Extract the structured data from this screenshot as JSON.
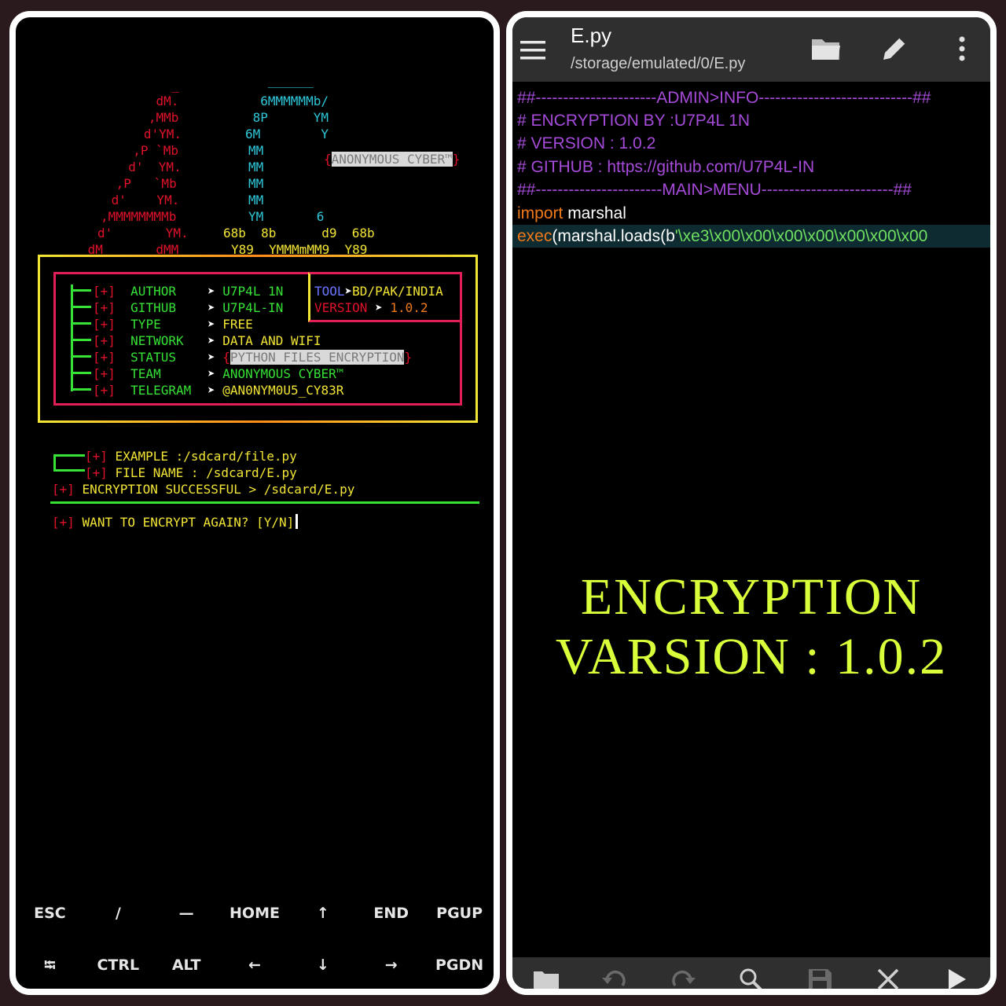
{
  "terminal": {
    "ascii_a": [
      "     _",
      "    dM.",
      "   ,MMb",
      "   d'YM.",
      "  ,P `Mb",
      "  d'  YM.",
      " ,P   `Mb",
      " d'    YM.",
      ",MMMMMMMMb",
      "d'       YM."
    ],
    "ascii_a_last": "_dM_     _dMM_",
    "ascii_c_cyan": [
      "   ______",
      "  6MMMMMMb/",
      " 8P      YM",
      "6M        Y",
      "MM",
      "MM",
      "MM",
      "MM",
      "YM       6"
    ],
    "ascii_c_tail1": "68b  8b      d9  68b",
    "ascii_c_tail2": "Y89  YMMMmMM9  Y89",
    "badge": "ANONYMOUS CYBER™",
    "info_rows": [
      {
        "tag": "[+]",
        "key": "AUTHOR",
        "value": "U7P4L 1N"
      },
      {
        "tag": "[+]",
        "key": "GITHUB",
        "value": "U7P4L-IN"
      },
      {
        "tag": "[+]",
        "key": "TYPE",
        "value": "FREE"
      },
      {
        "tag": "[+]",
        "key": "NETWORK",
        "value": "DATA AND WIFI"
      },
      {
        "tag": "[+]",
        "key": "STATUS",
        "value": "PYTHON FILES ENCRYPTION"
      },
      {
        "tag": "[+]",
        "key": "TEAM",
        "value": "ANONYMOUS CYBER™"
      },
      {
        "tag": "[+]",
        "key": "TELEGRAM",
        "value": "@AN0NYM0U5_CY83R"
      }
    ],
    "tool_label": "TOOL",
    "tool_value": "BD/PAK/INDIA",
    "version_label": "VERSION",
    "version_value": "1.0.2",
    "arrow": "➤",
    "example_line": "[+] EXAMPLE :/sdcard/file.py",
    "filename_line": "[+] FILE NAME : /sdcard/E.py",
    "success_tag": "[+]",
    "success_text": "ENCRYPTION SUCCESSFUL > /sdcard/E.py",
    "prompt_tag": "[+]",
    "prompt_text": "WANT TO ENCRYPT AGAIN? [Y/N]"
  },
  "extra_keys": {
    "row1": [
      "ESC",
      "/",
      "—",
      "HOME",
      "↑",
      "END",
      "PGUP"
    ],
    "row2": [
      "⭾",
      "CTRL",
      "ALT",
      "←",
      "↓",
      "→",
      "PGDN"
    ]
  },
  "editor": {
    "file_name": "E.py",
    "file_path": "/storage/emulated/0/E.py",
    "code": {
      "line1": "##----------------------ADMIN>INFO----------------------------##",
      "line2": "# ENCRYPTION BY :U7P4L 1N",
      "line3": "# VERSION : 1.0.2",
      "line4": "# GITHUB : https://github.com/U7P4L-IN",
      "line5": "##-----------------------MAIN>MENU------------------------##",
      "line6_kw": "import",
      "line6_rest": " marshal",
      "line7_kw": "exec",
      "line7_mid": "(marshal.loads(b",
      "line7_str": "'\\xe3\\x00\\x00\\x00\\x00\\x00\\x00\\x00"
    },
    "overlay_line1": "ENCRYPTION",
    "overlay_line2": "VARSION : 1.0.2"
  },
  "colors": {
    "terminal_red": "#e0122a",
    "terminal_cyan": "#2ec7d8",
    "terminal_yellow": "#f2e535",
    "terminal_green": "#35e235",
    "overlay_lime": "#d9ff3a"
  },
  "icons": {
    "appbar": [
      "menu-icon",
      "folder-open-icon",
      "pencil-icon",
      "more-vert-icon"
    ],
    "bottombar": [
      "folder-icon",
      "undo-icon",
      "redo-icon",
      "search-icon",
      "save-icon",
      "close-icon",
      "run-icon"
    ]
  }
}
